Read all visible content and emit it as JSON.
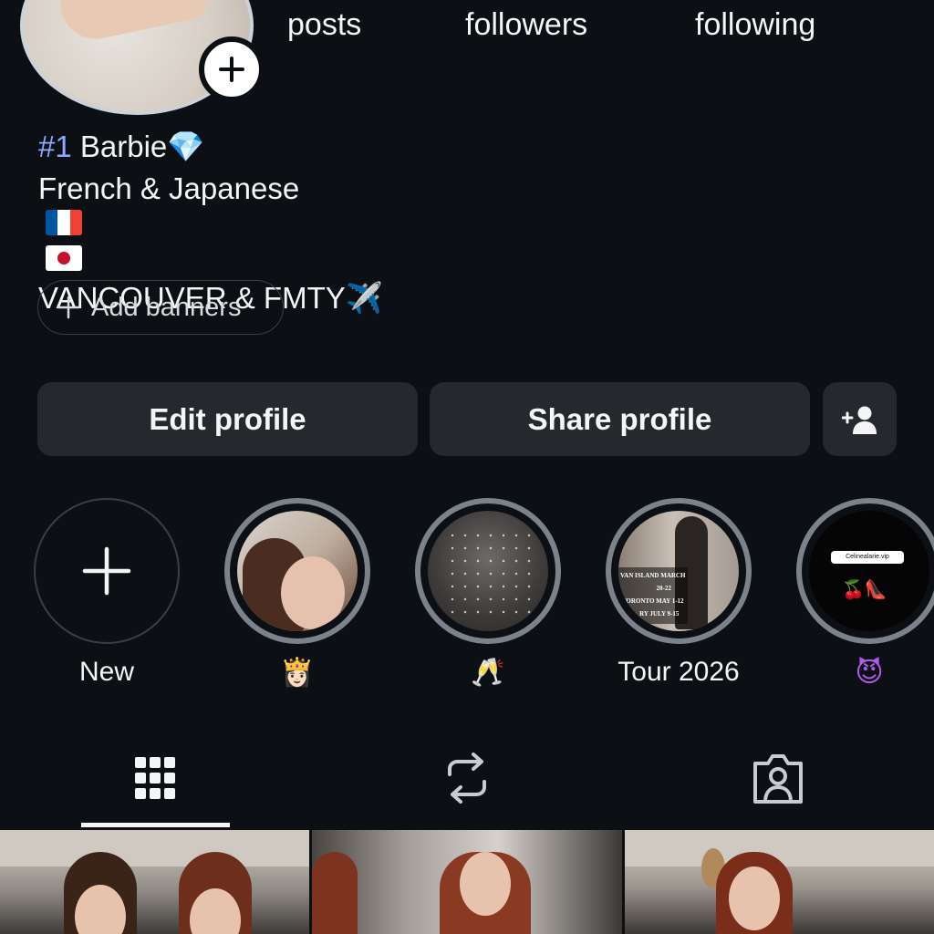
{
  "profile": {
    "stats": {
      "posts_label": "posts",
      "followers_label": "followers",
      "following_label": "following"
    },
    "bio": {
      "line1_hash": "#1",
      "line1_text": " Barbie",
      "line1_emoji": "💎",
      "line2_text": "French & Japanese",
      "line3_text": "VANCOUVER & FMTY",
      "line3_emoji": "✈️"
    },
    "add_banners_label": "Add banners",
    "edit_profile_label": "Edit profile",
    "share_profile_label": "Share profile"
  },
  "highlights": [
    {
      "label": "New"
    },
    {
      "label": "👸🏻"
    },
    {
      "label": "🥂"
    },
    {
      "label": "Tour 2026",
      "cover_text": [
        "VAN ISLAND MARCH",
        "20-22",
        "TORONTO MAY 1-12",
        "RY JULY 9-15"
      ]
    },
    {
      "label": "😈",
      "cover_pill": "Celinealarie.vip",
      "cover_emoji": "🍒👠"
    }
  ],
  "tabs": [
    {
      "name": "grid-icon",
      "active": true
    },
    {
      "name": "reposts-icon",
      "active": false
    },
    {
      "name": "tagged-icon",
      "active": false
    }
  ],
  "colors": {
    "background": "#0c1014",
    "button_bg": "#25292e",
    "hashtag": "#8ea9ff",
    "text": "#f5f5f5"
  }
}
